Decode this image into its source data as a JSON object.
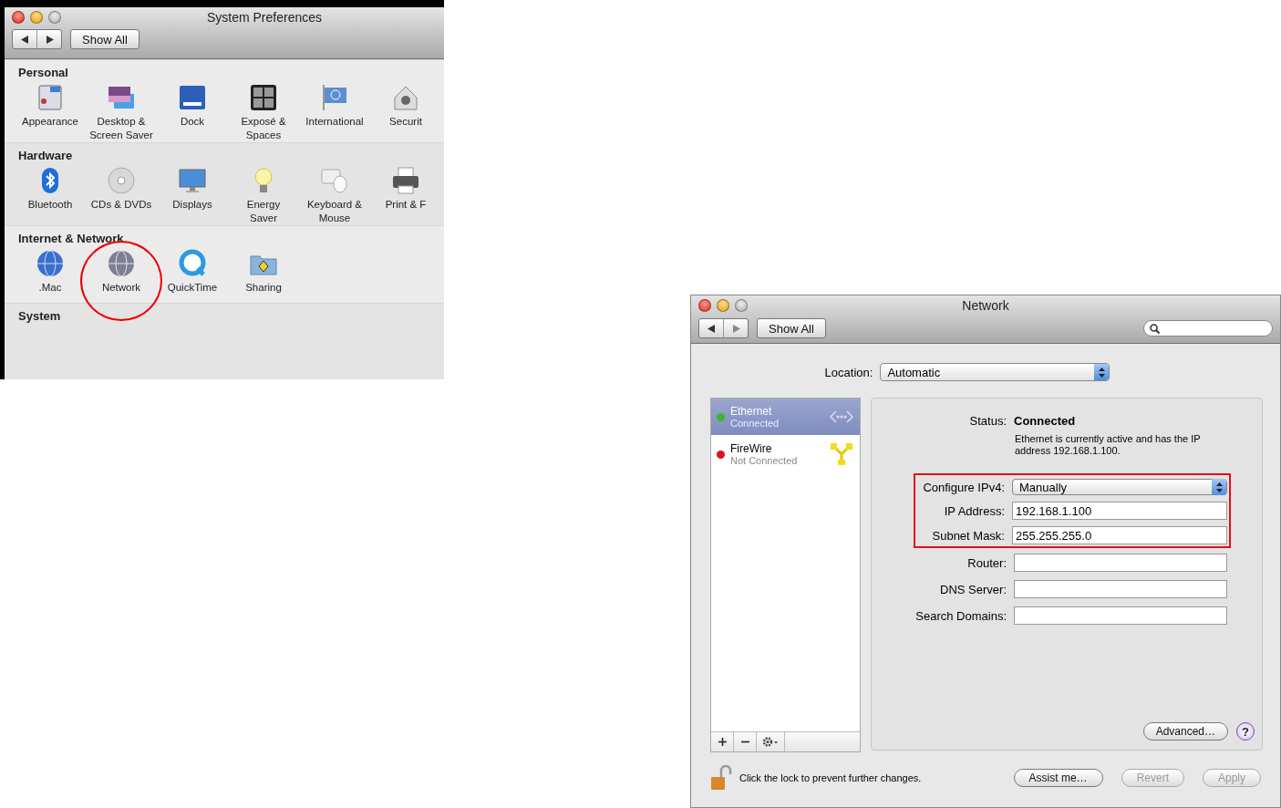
{
  "preferences_window": {
    "title": "System Preferences",
    "show_all": "Show All",
    "sections": [
      {
        "title": "Personal",
        "items": [
          {
            "label": "Appearance",
            "highlighted": false
          },
          {
            "label": "Desktop &\nScreen Saver",
            "highlighted": false
          },
          {
            "label": "Dock",
            "highlighted": false
          },
          {
            "label": "Exposé &\nSpaces",
            "highlighted": false
          },
          {
            "label": "International",
            "highlighted": false
          },
          {
            "label": "Securit",
            "highlighted": false
          }
        ]
      },
      {
        "title": "Hardware",
        "items": [
          {
            "label": "Bluetooth",
            "highlighted": false
          },
          {
            "label": "CDs & DVDs",
            "highlighted": false
          },
          {
            "label": "Displays",
            "highlighted": false
          },
          {
            "label": "Energy\nSaver",
            "highlighted": false
          },
          {
            "label": "Keyboard &\nMouse",
            "highlighted": false
          },
          {
            "label": "Print & F",
            "highlighted": false
          }
        ]
      },
      {
        "title": "Internet & Network",
        "items": [
          {
            "label": ".Mac",
            "highlighted": false
          },
          {
            "label": "Network",
            "highlighted": true
          },
          {
            "label": "QuickTime",
            "highlighted": false
          },
          {
            "label": "Sharing",
            "highlighted": false
          }
        ]
      },
      {
        "title": "System"
      }
    ]
  },
  "network_window": {
    "title": "Network",
    "show_all": "Show All",
    "location": {
      "label": "Location:",
      "value": "Automatic"
    },
    "services": [
      {
        "name": "Ethernet",
        "status": "Connected",
        "selected": true,
        "color": "#3fb52a"
      },
      {
        "name": "FireWire",
        "status": "Not Connected",
        "selected": false,
        "color": "#d8171b"
      }
    ],
    "status": {
      "label": "Status:",
      "value": "Connected",
      "description": "Ethernet is currently active and has the IP address 192.168.1.100."
    },
    "fields": [
      {
        "kind": "select",
        "label": "Configure IPv4:",
        "value": "Manually",
        "highlighted": true
      },
      {
        "kind": "text",
        "label": "IP Address:",
        "value": "192.168.1.100",
        "highlighted": true
      },
      {
        "kind": "text",
        "label": "Subnet Mask:",
        "value": "255.255.255.0",
        "highlighted": true
      },
      {
        "kind": "text",
        "label": "Router:",
        "highlighted": false
      },
      {
        "kind": "text",
        "label": "DNS Server:",
        "highlighted": false
      },
      {
        "kind": "text",
        "label": "Search Domains:",
        "highlighted": false
      }
    ],
    "advanced": "Advanced…",
    "help": "?",
    "lock_text": "Click the lock to prevent further changes.",
    "buttons": [
      {
        "label": "Assist me…",
        "disabled": false
      },
      {
        "label": "Revert",
        "disabled": true
      },
      {
        "label": "Apply",
        "disabled": true
      }
    ]
  }
}
